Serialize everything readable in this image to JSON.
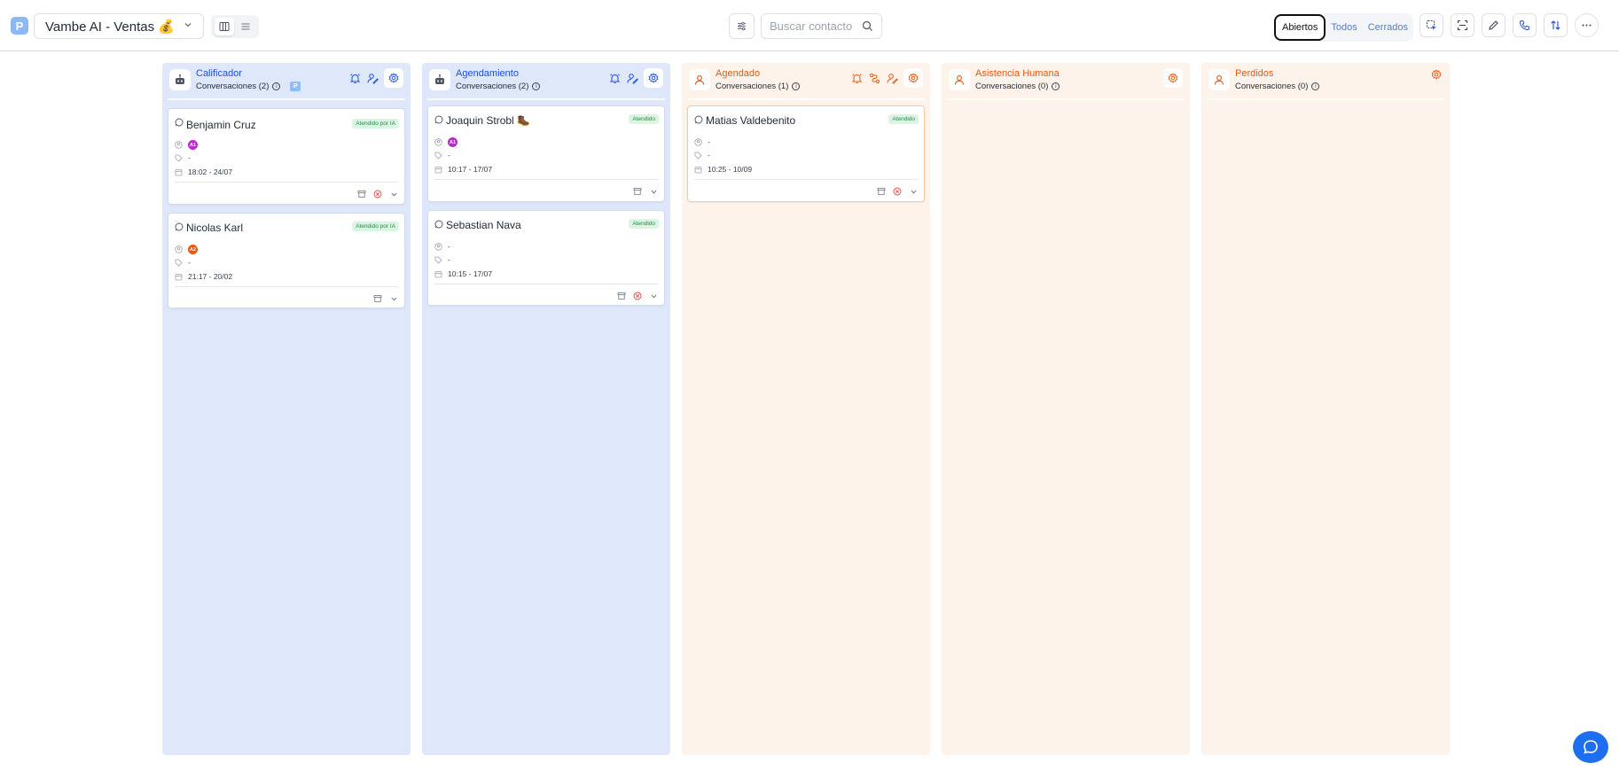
{
  "header": {
    "logo_letter": "P",
    "pipeline_name": "Vambe AI - Ventas 💰",
    "search_placeholder": "Buscar contacto",
    "status_tabs": [
      "Abiertos",
      "Todos",
      "Cerrados"
    ],
    "active_status_tab": "Abiertos"
  },
  "colors": {
    "accent_blue": "#1d4ed8",
    "accent_orange": "#ea580c",
    "badge_green": "#208c45",
    "column_blue": "#dfe7fb",
    "column_orange": "#fef3ea"
  },
  "columns": [
    {
      "title": "Calificador",
      "count_label": "Conversaciones (2)",
      "chip": "P",
      "cards": [
        {
          "name": "Benjamin Cruz",
          "badge": "Atendido por IA",
          "avatar": "A1",
          "avatar_color": "#c026d3",
          "tags": "-",
          "date": "18:02 - 24/07"
        },
        {
          "name": "Nicolas Karl",
          "badge": "Atendido por IA",
          "avatar": "A2",
          "avatar_color": "#ea580c",
          "tags": "-",
          "date": "21:17 - 20/02"
        }
      ]
    },
    {
      "title": "Agendamiento",
      "count_label": "Conversaciones (2)",
      "cards": [
        {
          "name": "Joaquin Strobl 🥾",
          "badge": "Atendido",
          "avatar": "A1",
          "avatar_color": "#c026d3",
          "tags": "-",
          "date": "10:17 - 17/07"
        },
        {
          "name": "Sebastian Nava",
          "badge": "Atendido",
          "assignee": "-",
          "tags": "-",
          "date": "10:15 - 17/07"
        }
      ]
    },
    {
      "title": "Agendado",
      "count_label": "Conversaciones (1)",
      "cards": [
        {
          "name": "Matias Valdebenito",
          "badge": "Atendido",
          "assignee": "-",
          "tags": "-",
          "date": "10:25 - 10/09"
        }
      ]
    },
    {
      "title": "Asistencia Humana",
      "count_label": "Conversaciones (0)",
      "cards": []
    },
    {
      "title": "Perdidos",
      "count_label": "Conversaciones (0)",
      "cards": []
    }
  ]
}
